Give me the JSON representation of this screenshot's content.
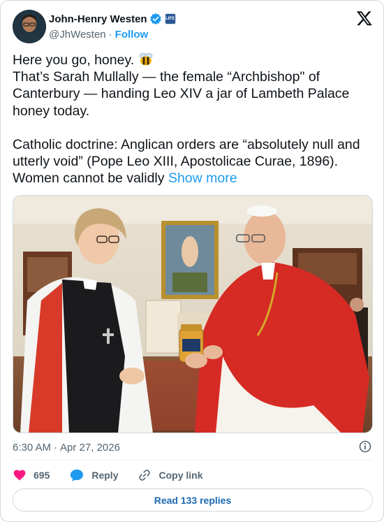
{
  "author": {
    "name": "John-Henry Westen",
    "handle": "@JhWesten",
    "separator": "·",
    "follow_label": "Follow",
    "affiliate_badge": "LIFE"
  },
  "tweet": {
    "line1": "Here you go, honey. ",
    "line2": "That’s Sarah Mullally — the female “Archbishop\" of Canterbury — handing Leo XIV a jar of Lambeth Palace honey today.",
    "line3": "Catholic doctrine: Anglican orders are “absolutely null and utterly void” (Pope Leo XIII, Apostolicae Curae, 1896). Women cannot be validly ",
    "show_more": "Show more"
  },
  "meta": {
    "time": "6:30 AM",
    "separator": "·",
    "date": "Apr 27, 2026"
  },
  "actions": {
    "likes": "695",
    "reply_label": "Reply",
    "copy_link_label": "Copy link"
  },
  "read_replies_label": "Read 133 replies",
  "colors": {
    "accent": "#1d9bf0",
    "like": "#f91880",
    "text": "#0f1419",
    "muted": "#536471"
  },
  "icons": [
    "verified-badge-icon",
    "x-logo-icon",
    "bee-emoji-icon",
    "info-icon",
    "heart-icon",
    "reply-bubble-icon",
    "link-icon"
  ]
}
